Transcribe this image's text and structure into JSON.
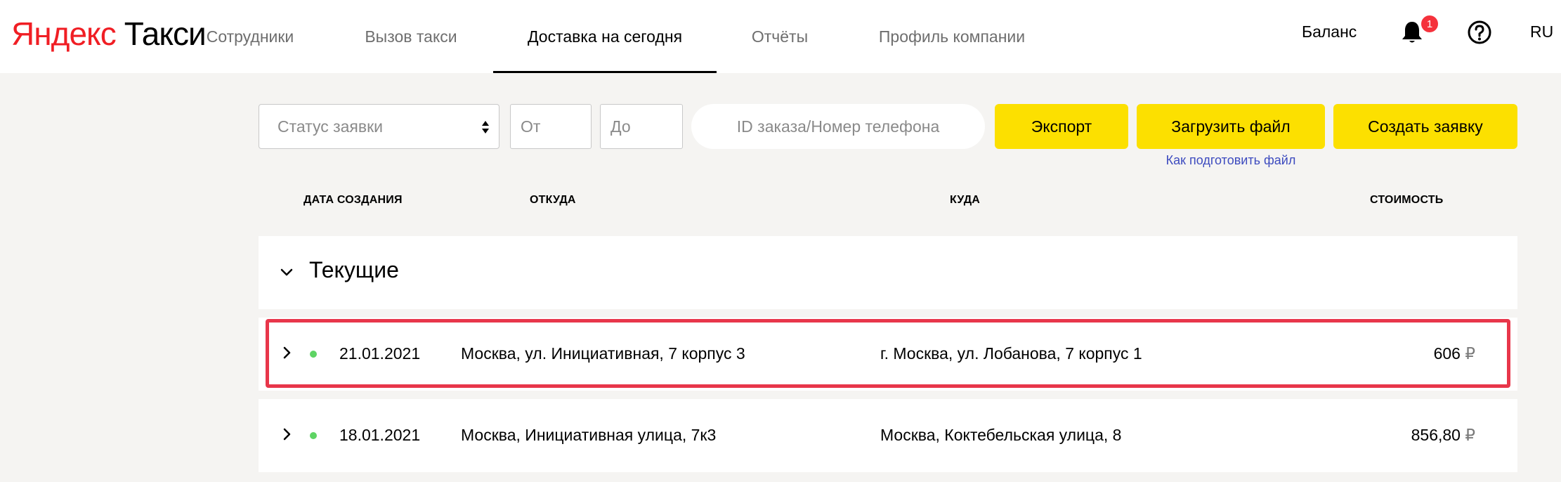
{
  "header": {
    "logo_part1": "Яндекс",
    "logo_part2": "Такси",
    "tabs": [
      {
        "label": "Сотрудники"
      },
      {
        "label": "Вызов такси"
      },
      {
        "label": "Доставка на сегодня",
        "active": true
      },
      {
        "label": "Отчёты"
      },
      {
        "label": "Профиль компании"
      }
    ],
    "balance": "Баланс",
    "notifications_count": "1",
    "language": "RU",
    "icons": [
      "bell-icon",
      "help-icon"
    ]
  },
  "filters": {
    "status_placeholder": "Статус заявки",
    "from_placeholder": "От",
    "to_placeholder": "До",
    "search_placeholder": "ID заказа/Номер телефона",
    "export_label": "Экспорт",
    "upload_label": "Загрузить файл",
    "create_label": "Создать заявку",
    "upload_help_link": "Как подготовить файл"
  },
  "columns": {
    "date": "ДАТА СОЗДАНИЯ",
    "from": "ОТКУДА",
    "to": "КУДА",
    "cost": "СТОИМОСТЬ"
  },
  "section": {
    "title": "Текущие"
  },
  "rows": [
    {
      "date": "21.01.2021",
      "from": "Москва, ул. Инициативная, 7 корпус 3",
      "to": "г. Москва, ул. Лобанова, 7 корпус 1",
      "cost": "606",
      "currency": "₽",
      "status": "active",
      "highlighted": true
    },
    {
      "date": "18.01.2021",
      "from": "Москва, Инициативная улица, 7к3",
      "to": "Москва, Коктебельская улица, 8",
      "cost": "856,80",
      "currency": "₽",
      "status": "active",
      "highlighted": false
    }
  ],
  "colors": {
    "accent_yellow": "#fce000",
    "status_green": "#5ed464",
    "highlight_red": "#e8364a",
    "link_blue": "#3d4bbf",
    "logo_red": "#f01e24"
  }
}
